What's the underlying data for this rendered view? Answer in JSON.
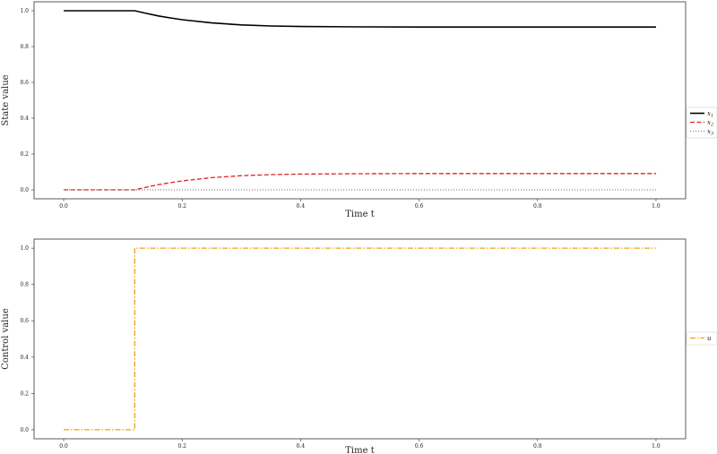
{
  "chart_data": [
    {
      "type": "line",
      "xlabel": "Time t",
      "ylabel": "State value",
      "xlim": [
        -0.05,
        1.05
      ],
      "ylim": [
        -0.05,
        1.05
      ],
      "xticks": [
        0.0,
        0.2,
        0.4,
        0.6,
        0.8,
        1.0
      ],
      "xtick_labels": [
        "0.0",
        "0.2",
        "0.4",
        "0.6",
        "0.8",
        "1.0"
      ],
      "yticks": [
        0.0,
        0.2,
        0.4,
        0.6,
        0.8,
        1.0
      ],
      "ytick_labels": [
        "0.0",
        "0.2",
        "0.4",
        "0.6",
        "0.8",
        "1.0"
      ],
      "grid": false,
      "legend_position": "right",
      "series": [
        {
          "name": "x1",
          "legend_base": "x",
          "legend_sub": "1",
          "color": "#000000",
          "dash": "solid",
          "x": [
            0.0,
            0.12,
            0.14,
            0.16,
            0.18,
            0.2,
            0.25,
            0.3,
            0.35,
            0.4,
            0.5,
            0.6,
            0.7,
            0.8,
            0.9,
            1.0
          ],
          "y": [
            1.0,
            1.0,
            0.985,
            0.971,
            0.96,
            0.95,
            0.932,
            0.921,
            0.915,
            0.912,
            0.91,
            0.909,
            0.909,
            0.909,
            0.909,
            0.909
          ]
        },
        {
          "name": "x2",
          "legend_base": "x",
          "legend_sub": "2",
          "color": "#e02020",
          "dash": "dashed",
          "x": [
            0.0,
            0.12,
            0.14,
            0.16,
            0.18,
            0.2,
            0.25,
            0.3,
            0.35,
            0.4,
            0.5,
            0.6,
            0.7,
            0.8,
            0.9,
            1.0
          ],
          "y": [
            0.0,
            0.0,
            0.015,
            0.029,
            0.04,
            0.05,
            0.068,
            0.079,
            0.085,
            0.088,
            0.09,
            0.091,
            0.091,
            0.091,
            0.091,
            0.091
          ]
        },
        {
          "name": "x3",
          "legend_base": "x",
          "legend_sub": "3",
          "color": "#808080",
          "dash": "dotted",
          "x": [
            0.0,
            1.0
          ],
          "y": [
            0.0,
            0.0
          ]
        }
      ]
    },
    {
      "type": "line",
      "xlabel": "Time t",
      "ylabel": "Control value",
      "xlim": [
        -0.05,
        1.05
      ],
      "ylim": [
        -0.05,
        1.05
      ],
      "xticks": [
        0.0,
        0.2,
        0.4,
        0.6,
        0.8,
        1.0
      ],
      "xtick_labels": [
        "0.0",
        "0.2",
        "0.4",
        "0.6",
        "0.8",
        "1.0"
      ],
      "yticks": [
        0.0,
        0.2,
        0.4,
        0.6,
        0.8,
        1.0
      ],
      "ytick_labels": [
        "0.0",
        "0.2",
        "0.4",
        "0.6",
        "0.8",
        "1.0"
      ],
      "grid": false,
      "legend_position": "right",
      "series": [
        {
          "name": "u",
          "legend_base": "u",
          "legend_sub": "",
          "color": "#f0a010",
          "dash": "dashdot",
          "x": [
            0.0,
            0.12,
            0.12,
            1.0
          ],
          "y": [
            0.0,
            0.0,
            1.0,
            1.0
          ]
        }
      ]
    }
  ]
}
